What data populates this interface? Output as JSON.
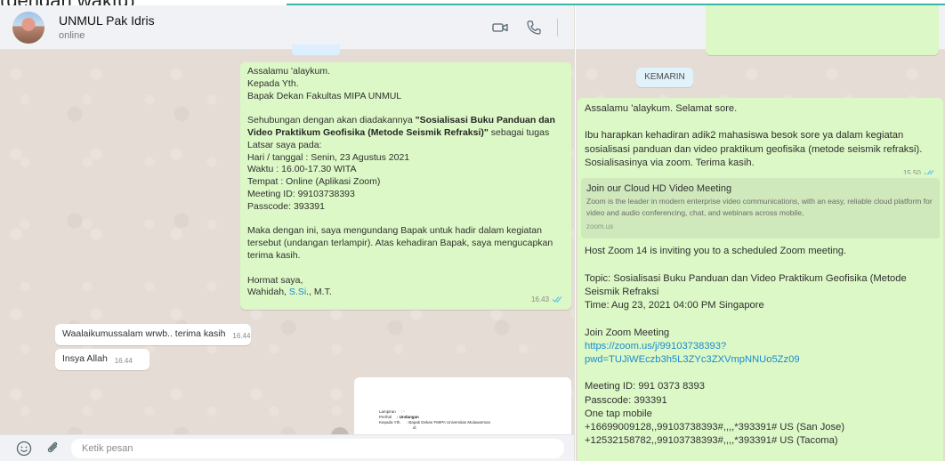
{
  "top_fragment": {
    "text": "(dengan waktu)"
  },
  "header": {
    "contact_name": "UNMUL Pak Idris",
    "contact_status": "online",
    "icons": [
      "video-camera-icon",
      "phone-icon"
    ]
  },
  "left_chat": {
    "msg1": {
      "lines": [
        "Assalamu 'alaykum.",
        "Kepada Yth.",
        "Bapak Dekan Fakultas MIPA UNMUL",
        "",
        "Sehubungan dengan akan diadakannya ",
        "Sosialisasi Buku Panduan dan",
        "Video Praktikum Geofisika (Metode Seismik Refraksi)\"",
        " sebagai tugas",
        "Latsar saya pada:",
        "Hari / tanggal : Senin, 23 Agustus 2021",
        "Waktu : 16.00-17.30 WITA",
        "Tempat : Online (Aplikasi Zoom)",
        "Meeting ID: 99103738393",
        "Passcode: 393391",
        "",
        "Maka dengan ini, saya mengundang Bapak untuk hadir dalam kegiatan",
        "tersebut (undangan  terlampir). Atas kehadiran Bapak, saya mengucapkan",
        "terima kasih.",
        "",
        "Hormat saya,",
        "Wahidah, ",
        "S.Si",
        "., M.T."
      ],
      "time": "16.43"
    },
    "msg2": {
      "text": "Waalaikumussalam wrwb.. terima kasih",
      "time": "16.44"
    },
    "msg3": {
      "text": "Insya Allah",
      "time": "16.44"
    },
    "doc_preview": {
      "rows": [
        [
          "Lampiran",
          ": -"
        ],
        [
          "Perihal",
          ": Undangan"
        ],
        [
          "Kepada Yth.",
          ": Bapak Dekan FMIPA Universitas Mulawarman"
        ],
        [
          "",
          "di"
        ]
      ]
    }
  },
  "footer": {
    "input_placeholder": "Ketik pesan",
    "icons": [
      "emoji-icon",
      "attach-icon"
    ]
  },
  "right_chat": {
    "date_chip": "KEMARIN",
    "msg1": {
      "lines": [
        "Assalamu 'alaykum. Selamat sore.",
        "",
        "Ibu harapkan kehadiran adik2 mahasiswa besok sore ya dalam kegiatan",
        "sosialisasi panduan dan video praktikum geofisika (metode seismik refraksi).",
        "Sosialisasinya via zoom. Terima kasih."
      ],
      "time": "15.50"
    },
    "msg2": {
      "preview": {
        "title": "Join our Cloud HD Video Meeting",
        "desc": "Zoom is the leader in modern enterprise video communications, with an easy, reliable cloud platform for video and audio conferencing, chat, and webinars across mobile,",
        "domain": "zoom.us"
      },
      "lines": [
        "Host Zoom 14 is inviting you to a scheduled Zoom meeting.",
        "",
        "Topic: Sosialisasi Buku Panduan dan Video Praktikum Geofisika (Metode",
        "Seismik Refraksi",
        "Time: Aug 23, 2021 04:00 PM Singapore",
        "",
        "Join Zoom Meeting"
      ],
      "link_lines": [
        "https://zoom.us/j/99103738393?",
        "pwd=TUJiWEczb3h5L3ZYc3ZXVmpNNUo5Zz09"
      ],
      "lines_after": [
        "",
        "Meeting ID: 991 0373 8393",
        "Passcode: 393391",
        "One tap mobile",
        "+16699009128,,99103738393#,,,,*393391# US (San Jose)",
        "+12532158782,,99103738393#,,,,*393391# US (Tacoma)"
      ]
    }
  },
  "colors": {
    "outgoing_bubble": "#dcf8c6",
    "incoming_bubble": "#ffffff",
    "chat_background": "#e5ddd5",
    "header_background": "#f0f2f5",
    "read_ticks": "#4fc3f7",
    "link": "#1a8bd0",
    "accent_line": "#3cb7a5"
  }
}
